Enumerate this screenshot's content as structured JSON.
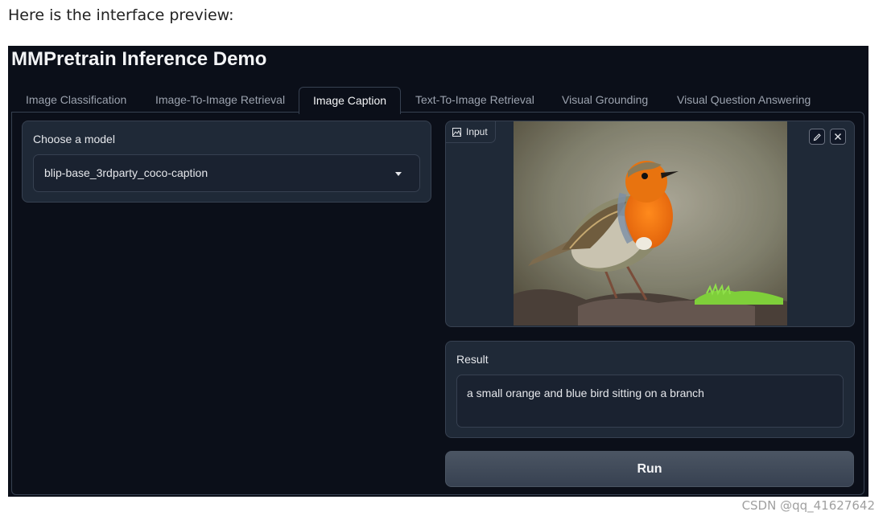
{
  "intro_text": "Here is the interface preview:",
  "app": {
    "title": "MMPretrain Inference Demo",
    "tabs": [
      {
        "label": "Image Classification",
        "active": false
      },
      {
        "label": "Image-To-Image Retrieval",
        "active": false
      },
      {
        "label": "Image Caption",
        "active": true
      },
      {
        "label": "Text-To-Image Retrieval",
        "active": false
      },
      {
        "label": "Visual Grounding",
        "active": false
      },
      {
        "label": "Visual Question Answering",
        "active": false
      }
    ],
    "model_selector": {
      "label": "Choose a model",
      "selected": "blip-base_3rdparty_coco-caption"
    },
    "input_image": {
      "label": "Input",
      "content": "photo of a robin perched on a mossy branch",
      "edit_icon": "pencil-icon",
      "close_icon": "close-icon"
    },
    "result": {
      "label": "Result",
      "value": "a small orange and blue bird sitting on a branch"
    },
    "run_button": {
      "label": "Run"
    }
  },
  "watermark": "CSDN @qq_41627642",
  "colors": {
    "app_background": "#0b0f19",
    "panel": "#1f2937",
    "border": "#374151",
    "text": "#e5e7eb",
    "muted_text": "#9ca3af"
  }
}
